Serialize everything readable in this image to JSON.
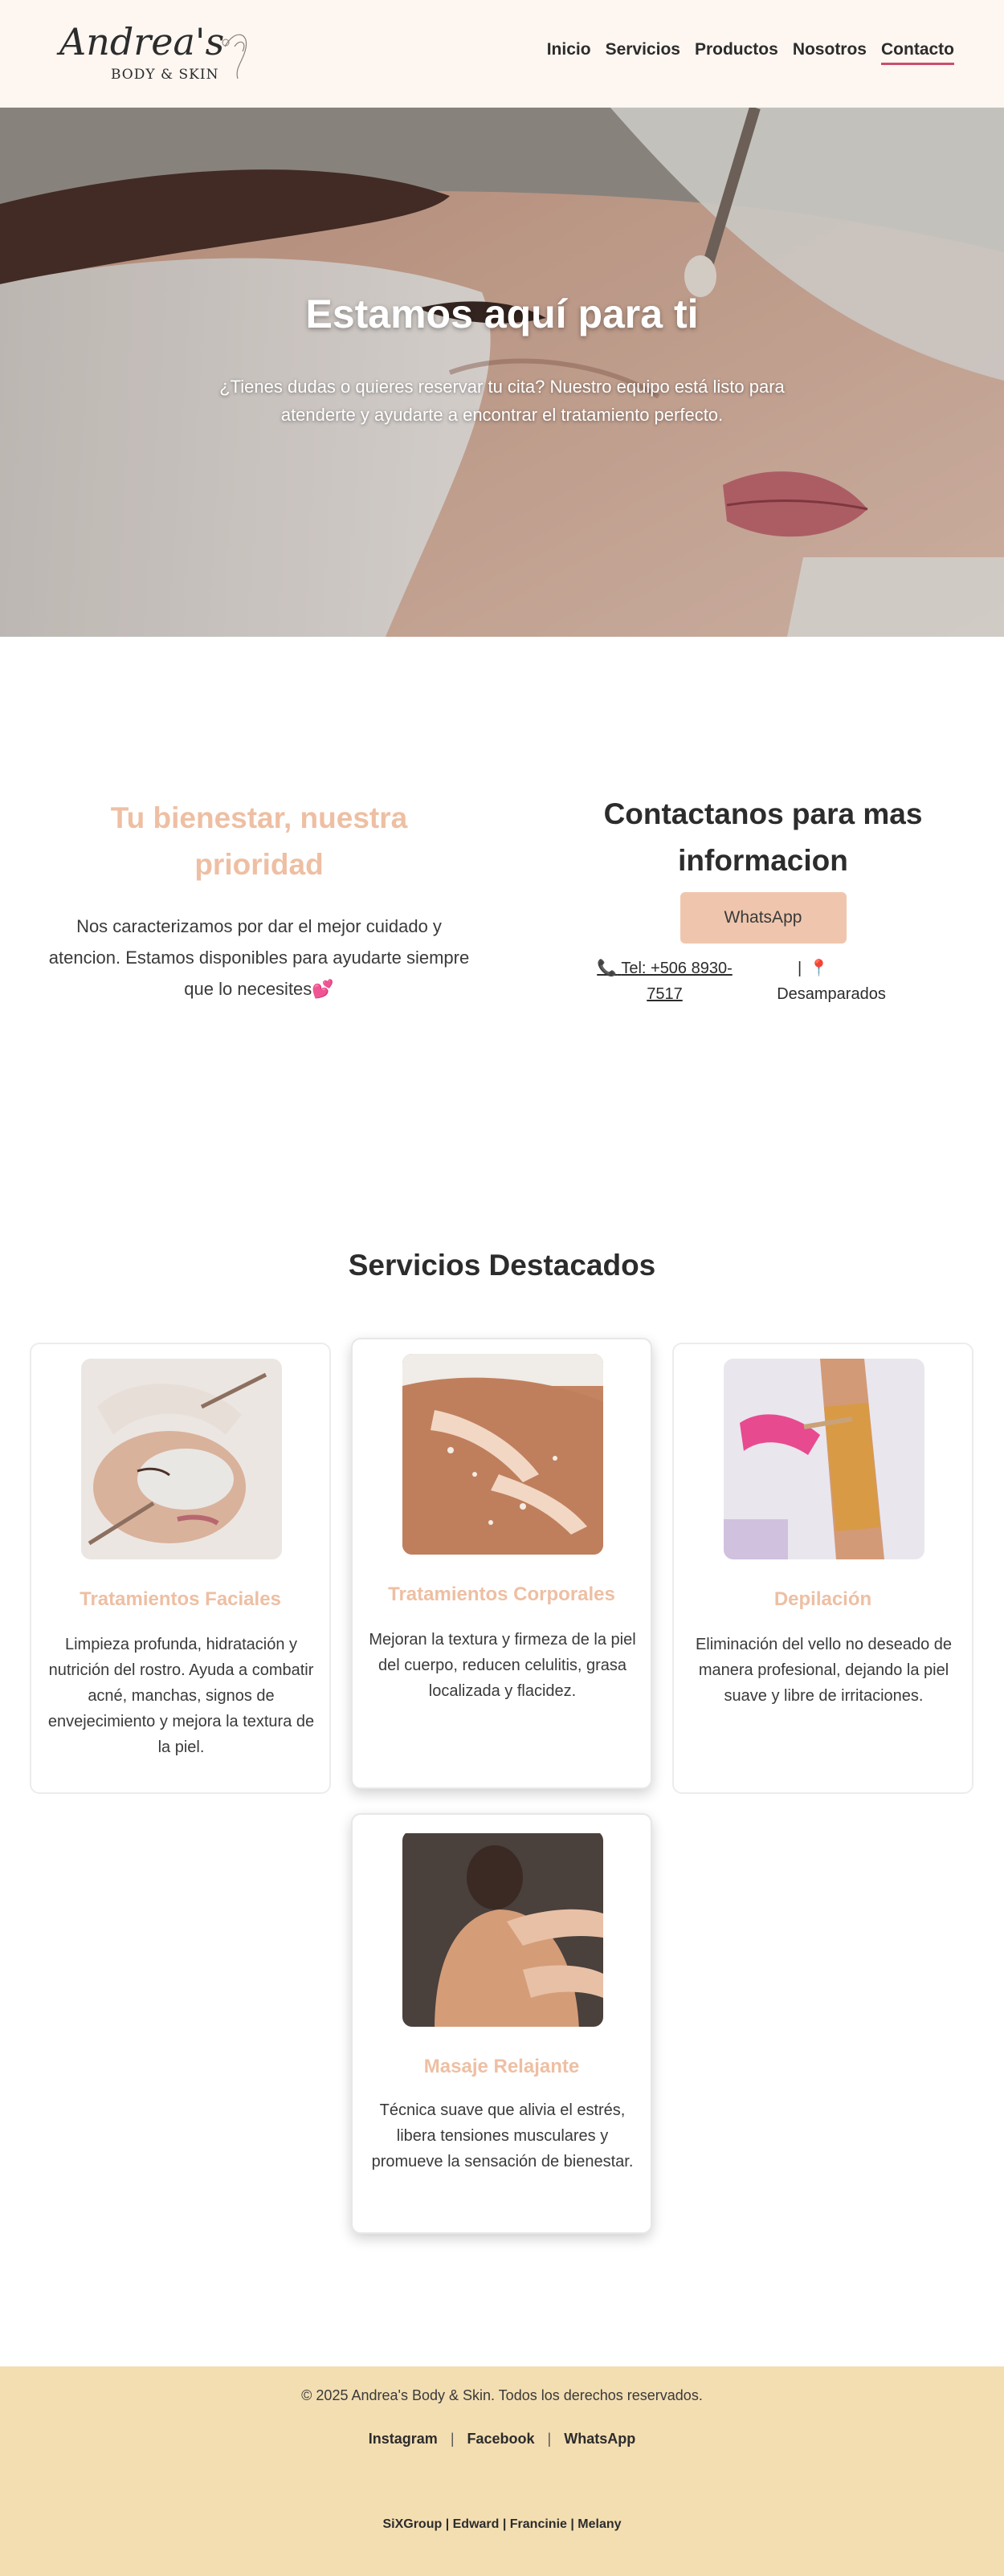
{
  "header": {
    "logo_text": "Andrea's",
    "logo_subtext": "BODY & SKIN",
    "nav": [
      {
        "label": "Inicio"
      },
      {
        "label": "Servicios"
      },
      {
        "label": "Productos"
      },
      {
        "label": "Nosotros"
      },
      {
        "label": "Contacto",
        "active": true
      }
    ]
  },
  "hero": {
    "title": "Estamos aquí para ti",
    "subtitle": "¿Tienes dudas o quieres reservar tu cita? Nuestro equipo está listo para atenderte y ayudarte a encontrar el tratamiento perfecto."
  },
  "about": {
    "title": "Tu bienestar, nuestra prioridad",
    "text": "Nos caracterizamos por dar el mejor cuidado y atencion. Estamos disponibles para ayudarte siempre que lo necesites"
  },
  "contact": {
    "title": "Contactanos para mas informacion",
    "whatsapp_label": "WhatsApp",
    "tel_label": "Tel: +506 8930-7517",
    "location": "Desamparados"
  },
  "services": {
    "title": "Servicios Destacados",
    "items": [
      {
        "title": "Tratamientos Faciales",
        "description": "Limpieza profunda, hidratación y nutrición del rostro. Ayuda a combatir acné, manchas, signos de envejecimiento y mejora la textura de la piel."
      },
      {
        "title": "Tratamientos Corporales",
        "description": "Mejoran la textura y firmeza de la piel del cuerpo, reducen celulitis, grasa localizada y flacidez."
      },
      {
        "title": "Depilación",
        "description": "Eliminación del vello no deseado de manera profesional, dejando la piel suave y libre de irritaciones."
      },
      {
        "title": "Masaje Relajante",
        "description": "Técnica suave que alivia el estrés, libera tensiones musculares y promueve la sensación de bienestar."
      }
    ]
  },
  "footer": {
    "copyright": "© 2025 Andrea's Body & Skin. Todos los derechos reservados.",
    "links": [
      {
        "label": "Instagram"
      },
      {
        "label": "Facebook"
      },
      {
        "label": "WhatsApp"
      }
    ],
    "credits": "SiXGroup | Edward | Francinie | Melany"
  },
  "colors": {
    "accent_peach": "#eebfa3",
    "button_peach": "#efc6ad",
    "header_bg": "#fdf6f1",
    "footer_bg": "#f3deb2",
    "active_underline": "#c94f6d"
  }
}
